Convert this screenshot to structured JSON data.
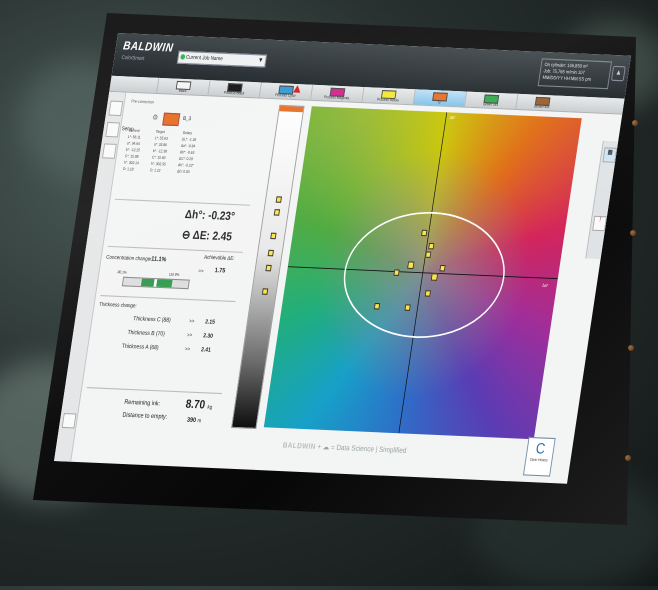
{
  "app": {
    "brand": "BALDWIN",
    "brand_sub": "ColorSmart",
    "job_name": "Current Job Name",
    "info_lines": [
      "On cylinder: 146,850 m²",
      "Job: 75,765 m/min 107",
      "MM/DD/YY HH:MM:SS pm"
    ]
  },
  "toolbar": {
    "step_label": "Setup",
    "help_label": "?",
    "inks": [
      {
        "label": "Black",
        "color": "#f5f5f5",
        "selected": false,
        "warn": false
      },
      {
        "label": "Process Black",
        "color": "#111111",
        "selected": false,
        "warn": false
      },
      {
        "label": "Process Cyan",
        "color": "#2f9ad6",
        "selected": false,
        "warn": true
      },
      {
        "label": "Process Magenta",
        "color": "#d0208a",
        "selected": false,
        "warn": false
      },
      {
        "label": "Process Yellow",
        "color": "#f3e62a",
        "selected": false,
        "warn": false
      },
      {
        "label": "G",
        "color": "#e66b1f",
        "selected": true,
        "warn": false
      },
      {
        "label": "Green 3xx",
        "color": "#2fa84a",
        "selected": false,
        "warn": false
      },
      {
        "label": "Brown 4xx",
        "color": "#9a5b2a",
        "selected": false,
        "warn": false
      }
    ]
  },
  "panel": {
    "toggle_label": "Pre-correction",
    "sample_label": "B_3",
    "headers": [
      "Current",
      "Target",
      "Deltas"
    ],
    "rows": [
      [
        "L*: 56.11",
        "L*: 55.63",
        "ΔL*: -1.26"
      ],
      [
        "a*: 34.64",
        "a*: 33.86",
        "Δa*: -0.64"
      ],
      [
        "b*: -12.25",
        "b*: -12.38",
        "Δb*: -0.63"
      ],
      [
        "C*: 15.88",
        "C*: 15.60",
        "ΔC*: 0.28"
      ],
      [
        "h°: 302.14",
        "h°: 302.35",
        "Δh°: -0.23°"
      ],
      [
        "D: 1.18",
        "D: 1.22",
        "ΔD: 0.03"
      ]
    ],
    "delta_h_label": "Δh°:",
    "delta_h_value": "-0.23°",
    "delta_e_label": "ΔE:",
    "delta_e_value": "2.45",
    "conc_label": "Concentration change:",
    "conc_value": "-11.1%",
    "conc_left": "-90.1%",
    "conc_right": "110.9%",
    "conc_fill": 0.47,
    "achievable_label": "Achievable ΔE:",
    "achievable_arrow": ">>",
    "achievable_value": "1.75",
    "thickness_title": "Thickness change:",
    "thickness": [
      {
        "label": "Thickness C (88)",
        "arrow": ">>",
        "value": "2.15"
      },
      {
        "label": "Thickness B (70)",
        "arrow": ">>",
        "value": "2.30"
      },
      {
        "label": "Thickness A (68)",
        "arrow": ">>",
        "value": "2.41"
      }
    ],
    "remaining_label": "Remaining ink:",
    "remaining_value": "8.70",
    "remaining_unit": "kg",
    "distance_label": "Distance to empty:",
    "distance_value": "390",
    "distance_unit": "m"
  },
  "plot": {
    "axis_top": "Δb*",
    "axis_right": "Δa*"
  },
  "footer": {
    "brand": "BALDWIN",
    "plus": "+",
    "eq": "=",
    "tagline": "Data Science | Simplified",
    "clear_letter": "C",
    "clear_label": "Clear History"
  }
}
